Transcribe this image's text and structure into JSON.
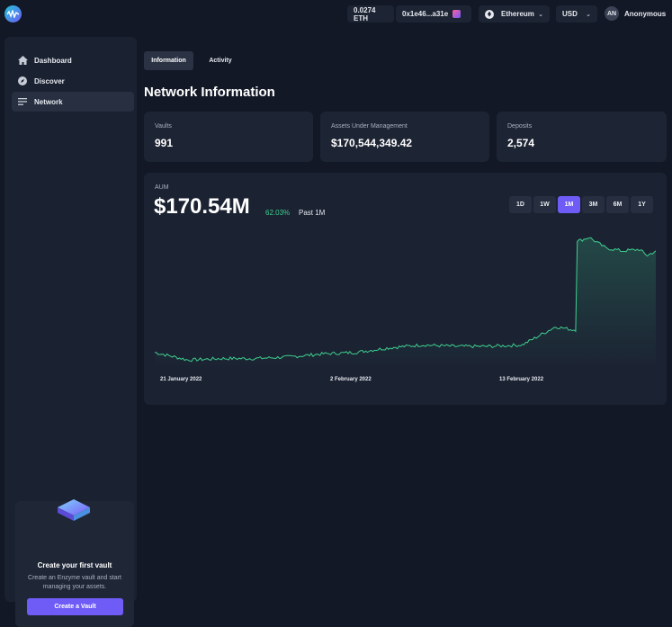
{
  "header": {
    "eth_balance": "0.0274 ETH",
    "address": "0x1e46...a31e",
    "network": "Ethereum",
    "currency": "USD",
    "user_initials": "AN",
    "user_name": "Anonymous"
  },
  "sidebar": {
    "items": [
      {
        "label": "Dashboard",
        "icon": "home-icon"
      },
      {
        "label": "Discover",
        "icon": "compass-icon"
      },
      {
        "label": "Network",
        "icon": "list-icon"
      }
    ],
    "cta": {
      "title": "Create your first vault",
      "description": "Create an Enzyme vault and start managing your assets.",
      "button": "Create a Vault"
    }
  },
  "tabs": [
    "Information",
    "Activity"
  ],
  "page_title": "Network Information",
  "stats": [
    {
      "label": "Vaults",
      "value": "991"
    },
    {
      "label": "Assets Under Management",
      "value": "$170,544,349.42"
    },
    {
      "label": "Deposits",
      "value": "2,574"
    }
  ],
  "aum": {
    "label": "AUM",
    "value": "$170.54M",
    "change": "62.03%",
    "period": "Past 1M",
    "ranges": [
      "1D",
      "1W",
      "1M",
      "3M",
      "6M",
      "1Y"
    ],
    "selected_range": "1M",
    "x_labels": [
      "21 January 2022",
      "2 February 2022",
      "13 February 2022"
    ]
  },
  "colors": {
    "accent": "#6f5cf6",
    "line": "#3ecf8e"
  },
  "chart_data": {
    "type": "area",
    "x": [
      0,
      2,
      4,
      6,
      8,
      10,
      12,
      14,
      16,
      18,
      20,
      22,
      24,
      25,
      25.5,
      26,
      27,
      28,
      29,
      29.5,
      30
    ],
    "values": [
      107,
      102,
      103,
      103,
      104,
      106,
      107,
      110,
      112,
      111,
      111,
      112,
      124,
      122,
      181,
      183,
      176,
      174,
      175,
      171,
      174
    ],
    "xlabel": "",
    "ylabel": "",
    "ylim": [
      95,
      190
    ]
  }
}
